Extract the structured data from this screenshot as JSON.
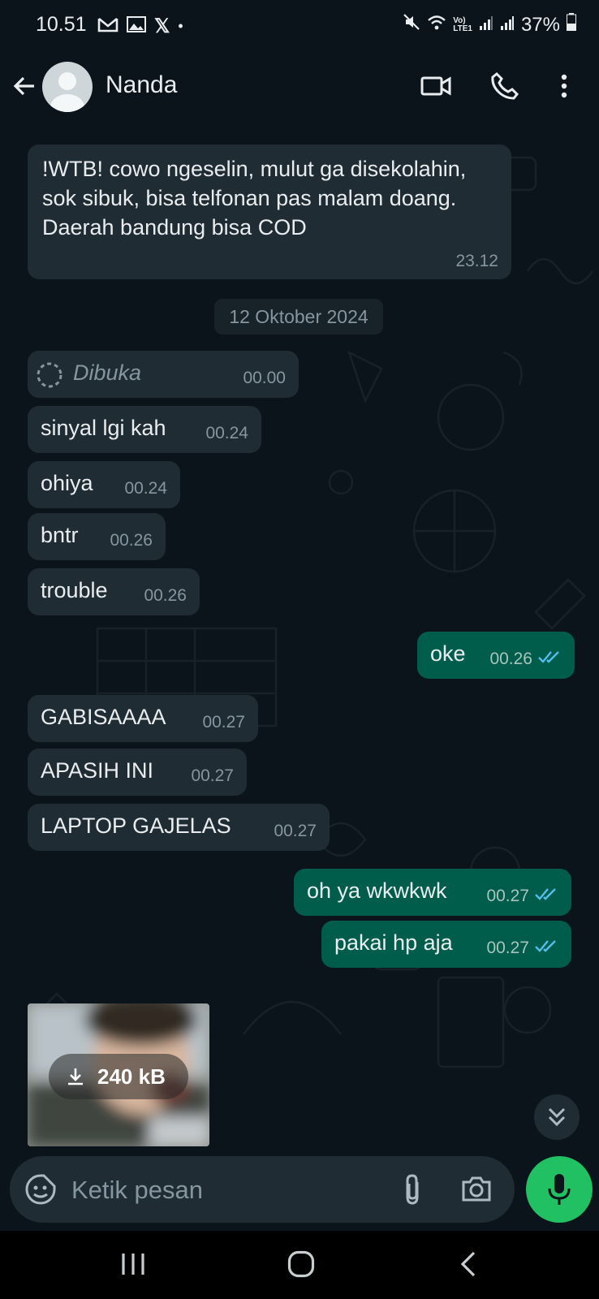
{
  "status_bar": {
    "time": "10.51",
    "battery": "37%"
  },
  "header": {
    "contact_name": "Nanda"
  },
  "messages": [
    {
      "dir": "in",
      "text": "!WTB! cowo ngeselin, mulut ga disekolahin, sok sibuk, bisa telfonan pas malam doang. Daerah bandung bisa COD",
      "time": "23.12"
    },
    {
      "dir": "date",
      "text": "12 Oktober 2024"
    },
    {
      "dir": "in",
      "text": "Dibuka",
      "time": "00.00",
      "italic": true
    },
    {
      "dir": "in",
      "text": "sinyal lgi kah",
      "time": "00.24"
    },
    {
      "dir": "in",
      "text": "ohiya",
      "time": "00.24"
    },
    {
      "dir": "in",
      "text": "bntr",
      "time": "00.26"
    },
    {
      "dir": "in",
      "text": "trouble",
      "time": "00.26"
    },
    {
      "dir": "out",
      "text": "oke",
      "time": "00.26"
    },
    {
      "dir": "in",
      "text": "GABISAAAA",
      "time": "00.27"
    },
    {
      "dir": "in",
      "text": "APASIH INI",
      "time": "00.27"
    },
    {
      "dir": "in",
      "text": "LAPTOP GAJELAS",
      "time": "00.27"
    },
    {
      "dir": "out",
      "text": "oh ya wkwkwk",
      "time": "00.27"
    },
    {
      "dir": "out",
      "text": "pakai hp aja",
      "time": "00.27"
    }
  ],
  "media": {
    "size": "240 kB"
  },
  "input": {
    "placeholder": "Ketik pesan"
  },
  "colors": {
    "incoming": "#202c33",
    "outgoing": "#005c4b",
    "mic": "#21c063",
    "read_ticks": "#53bdeb"
  },
  "icons": [
    "back-arrow-icon",
    "video-call-icon",
    "phone-icon",
    "more-vert-icon",
    "sticker-icon",
    "attach-icon",
    "camera-icon",
    "mic-icon",
    "download-icon",
    "double-chevron-down-icon"
  ]
}
